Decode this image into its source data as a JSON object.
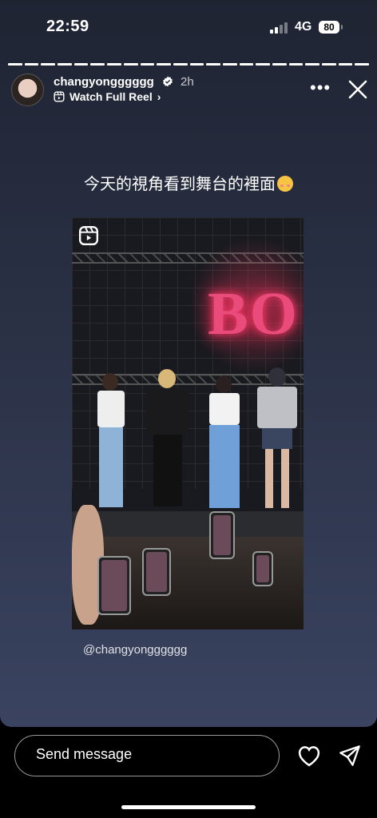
{
  "status_bar": {
    "time": "22:59",
    "network": "4G",
    "battery": "80"
  },
  "story": {
    "segment_count": 22,
    "active_segments": 22,
    "username": "changyongggggg",
    "age": "2h",
    "reel_link": "Watch Full Reel",
    "reel_link_chevron": "›",
    "more_label": "•••",
    "caption": "今天的視角看到舞台的裡面",
    "caption_emoji": "smiling-face-with-hearts",
    "video_sign_text": "BO",
    "credit": "@changyongggggg"
  },
  "composer": {
    "placeholder": "Send message"
  },
  "colors": {
    "sign_neon": "#e94b7a",
    "story_bg_top": "#1f2433",
    "story_bg_bottom": "#3a4360"
  }
}
